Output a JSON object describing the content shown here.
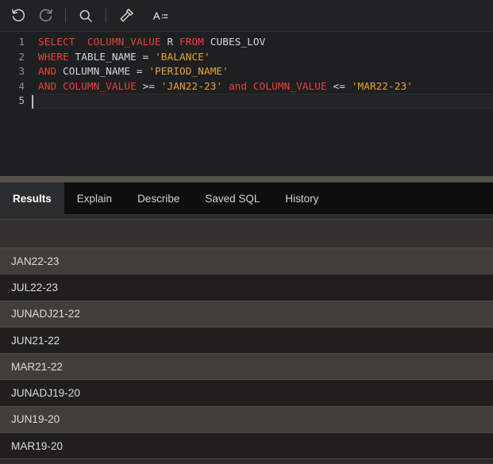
{
  "toolbar": {
    "buttons": [
      {
        "name": "undo-icon",
        "label": "Undo"
      },
      {
        "name": "redo-icon",
        "label": "Redo"
      },
      {
        "name": "search-icon",
        "label": "Find"
      },
      {
        "name": "hammer-icon",
        "label": "Build / Format"
      },
      {
        "name": "font-size-icon",
        "label": "A"
      }
    ]
  },
  "editor": {
    "lines": [
      {
        "number": "1",
        "tokens": [
          {
            "t": "SELECT",
            "c": "kw"
          },
          {
            "t": "  ",
            "c": "op"
          },
          {
            "t": "COLUMN_VALUE",
            "c": "kw"
          },
          {
            "t": " ",
            "c": "op"
          },
          {
            "t": "R",
            "c": "idf"
          },
          {
            "t": " ",
            "c": "op"
          },
          {
            "t": "FROM",
            "c": "kw"
          },
          {
            "t": " ",
            "c": "op"
          },
          {
            "t": "CUBES_LOV",
            "c": "idf"
          }
        ]
      },
      {
        "number": "2",
        "tokens": [
          {
            "t": "WHERE",
            "c": "kw"
          },
          {
            "t": " ",
            "c": "op"
          },
          {
            "t": "TABLE_NAME",
            "c": "idf"
          },
          {
            "t": " = ",
            "c": "op"
          },
          {
            "t": "'BALANCE'",
            "c": "str"
          }
        ]
      },
      {
        "number": "3",
        "tokens": [
          {
            "t": "AND",
            "c": "kw"
          },
          {
            "t": " ",
            "c": "op"
          },
          {
            "t": "COLUMN_NAME",
            "c": "idf"
          },
          {
            "t": " = ",
            "c": "op"
          },
          {
            "t": "'PERIOD_NAME'",
            "c": "str"
          }
        ]
      },
      {
        "number": "4",
        "tokens": [
          {
            "t": "AND COLUMN_VALUE",
            "c": "kw"
          },
          {
            "t": " >= ",
            "c": "op"
          },
          {
            "t": "'JAN22-23'",
            "c": "str"
          },
          {
            "t": " ",
            "c": "op"
          },
          {
            "t": "and COLUMN_VALUE",
            "c": "kw"
          },
          {
            "t": " <= ",
            "c": "op"
          },
          {
            "t": "'MAR22-23'",
            "c": "str"
          }
        ]
      },
      {
        "number": "5",
        "tokens": [],
        "active": true,
        "caret": true
      }
    ]
  },
  "tabs": [
    {
      "label": "Results",
      "active": true
    },
    {
      "label": "Explain",
      "active": false
    },
    {
      "label": "Describe",
      "active": false
    },
    {
      "label": "Saved SQL",
      "active": false
    },
    {
      "label": "History",
      "active": false
    }
  ],
  "results": {
    "header": [
      ""
    ],
    "rows": [
      [
        "JAN22-23"
      ],
      [
        "JUL22-23"
      ],
      [
        "JUNADJ21-22"
      ],
      [
        "JUN21-22"
      ],
      [
        "MAR21-22"
      ],
      [
        "JUNADJ19-20"
      ],
      [
        "JUN19-20"
      ],
      [
        "MAR19-20"
      ]
    ]
  },
  "colors": {
    "keyword": "#e8423a",
    "identifier": "#cfd8e3",
    "string": "#e8a33d",
    "operator": "#d9dce0",
    "editor_bg": "#1e1f20",
    "splitter": "#55514c",
    "row_odd": "#413e3a",
    "row_even": "#211f1e",
    "tab_active": "#2c2d2e"
  }
}
